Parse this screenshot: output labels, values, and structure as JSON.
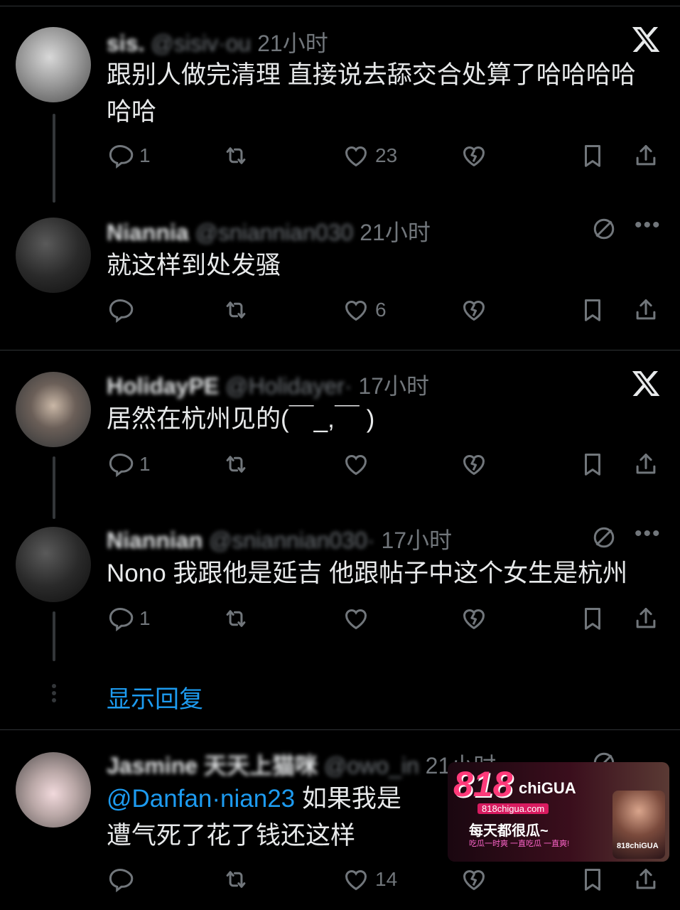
{
  "icons": {
    "reply": "reply-icon",
    "retweet": "retweet-icon",
    "like": "like-icon",
    "dislike": "dislike-icon",
    "bookmark": "bookmark-icon",
    "share": "share-icon",
    "x": "x-logo-icon",
    "more": "more-icon",
    "mute": "no-entry-icon"
  },
  "colors": {
    "bg": "#000000",
    "text": "#e7e9ea",
    "muted": "#71767b",
    "link": "#1d9bf0",
    "separator": "#2f3336"
  },
  "tweets": [
    {
      "name": "sis.",
      "handle": "@sisiv·ou",
      "time": "21小时",
      "text": [
        "跟别人做完清理 直接说去舔交合处算了哈哈哈哈",
        "哈哈"
      ],
      "reply_count": "1",
      "like_count": "23"
    },
    {
      "name": "Niannia",
      "handle": "@sniannian030",
      "time": "21小时",
      "text": [
        "就这样到处发骚"
      ],
      "reply_count": "",
      "like_count": "6"
    },
    {
      "name": "HolidayPE",
      "handle": "@Holidayer·",
      "time": "17小时",
      "text": [
        "居然在杭州见的(￣_,￣ )"
      ],
      "reply_count": "1",
      "like_count": ""
    },
    {
      "name": "Niannian",
      "handle": "@sniannian030·",
      "time": "17小时",
      "text": [
        "Nono 我跟他是延吉 他跟帖子中这个女生是杭州"
      ],
      "reply_count": "1",
      "like_count": ""
    },
    {
      "name": "Jasmine 天天上猫咪",
      "handle": "@owo_in",
      "time": "21小时",
      "mention": "@Danfan·nian23",
      "text": [
        "如果我是",
        "遭气死了花了钱还这样"
      ],
      "reply_count": "",
      "like_count": "14"
    }
  ],
  "show_replies": "显示回复",
  "ad": {
    "logo": "818",
    "logo_sub": "chiGUA",
    "site": "818chigua.com",
    "slogan": "每天都很瓜~",
    "tagline": "吃瓜一时爽 一直吃瓜 一直爽!",
    "badge": "818chiGUA"
  }
}
